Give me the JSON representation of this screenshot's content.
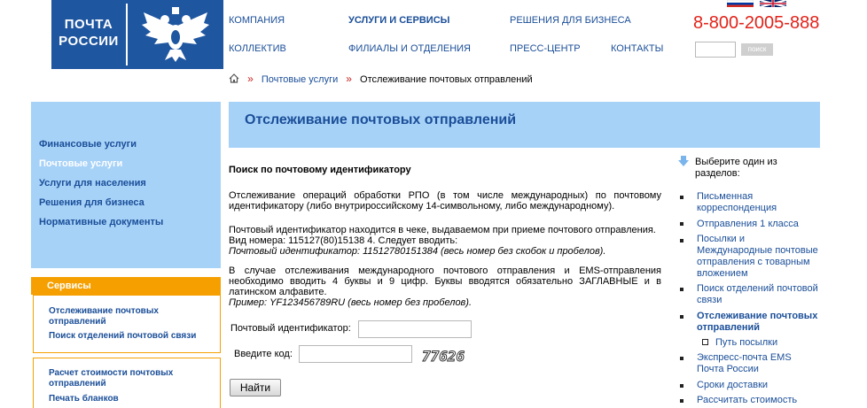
{
  "logo": {
    "text_line1": "ПОЧТА",
    "text_line2": "РОССИИ"
  },
  "topnav": {
    "company": "КОМПАНИЯ",
    "services": "УСЛУГИ И СЕРВИСЫ",
    "business_solutions": "РЕШЕНИЯ ДЛЯ БИЗНЕСА",
    "team": "КОЛЛЕКТИВ",
    "branches": "ФИЛИАЛЫ И ОТДЕЛЕНИЯ",
    "press": "ПРЕСС-ЦЕНТР",
    "contacts": "КОНТАКТЫ"
  },
  "phone": "8-800-2005-888",
  "search": {
    "button": "поиск",
    "value": ""
  },
  "breadcrumb": {
    "section": "Почтовые услуги",
    "current": "Отслеживание почтовых отправлений"
  },
  "sidebar": {
    "items": [
      {
        "label": "Финансовые услуги",
        "active": false
      },
      {
        "label": "Почтовые услуги",
        "active": true
      },
      {
        "label": "Услуги для населения",
        "active": false
      },
      {
        "label": "Решения для бизнеса",
        "active": false
      },
      {
        "label": "Нормативные документы",
        "active": false
      }
    ]
  },
  "services": {
    "title": "Сервисы",
    "box1": [
      "Отслеживание почтовых отправлений",
      "Поиск отделений почтовой связи"
    ],
    "box2": [
      "Расчет стоимости почтовых отправлений",
      "Печать бланков"
    ]
  },
  "main": {
    "title": "Отслеживание почтовых отправлений",
    "search_heading": "Поиск по почтовому идентификатору",
    "p1": "Отслеживание операций обработки РПО (в том числе международных) по почтовому идентификатору (либо внутрироссийскому 14-символьному, либо международному).",
    "p2_line1": "Почтовый идентификатор находится в чеке, выдаваемом при приеме почтового отправления.",
    "p2_line2": "Вид номера: 115127(80)15138 4. Следует вводить:",
    "p2_example": "Почтовый идентификатор: 11512780151384 (весь номер без скобок и пробелов).",
    "p3": "В случае отслеживания международного почтового отправления и EMS-отправления необходимо вводить 4 буквы и 9 цифр. Буквы вводятся обязательно ЗАГЛАВНЫЕ и в латинском алфавите.",
    "p3_example": "Пример: YF123456789RU (весь номер без пробелов).",
    "form": {
      "id_label": "Почтовый идентификатор:",
      "id_value": "",
      "code_label": "Введите код:",
      "code_value": "",
      "captcha": "77626",
      "submit": "Найти"
    }
  },
  "right": {
    "hint": "Выберите один из разделов:",
    "items": [
      "Письменная корреспонденция",
      "Отправления 1 класса",
      "Посылки и Международные почтовые отправления с товарным вложением",
      "Поиск отделений почтовой связи",
      "Отслеживание почтовых отправлений",
      "Путь посылки",
      "Экспресс-почта EMS Почта России",
      "Сроки доставки",
      "Рассчитать стоимость"
    ]
  },
  "colors": {
    "brand_blue": "#1f56a0",
    "link_blue": "#1a4e98",
    "light_blue": "#a7d2f8",
    "orange": "#f5a000",
    "phone_red": "#e2231a"
  }
}
